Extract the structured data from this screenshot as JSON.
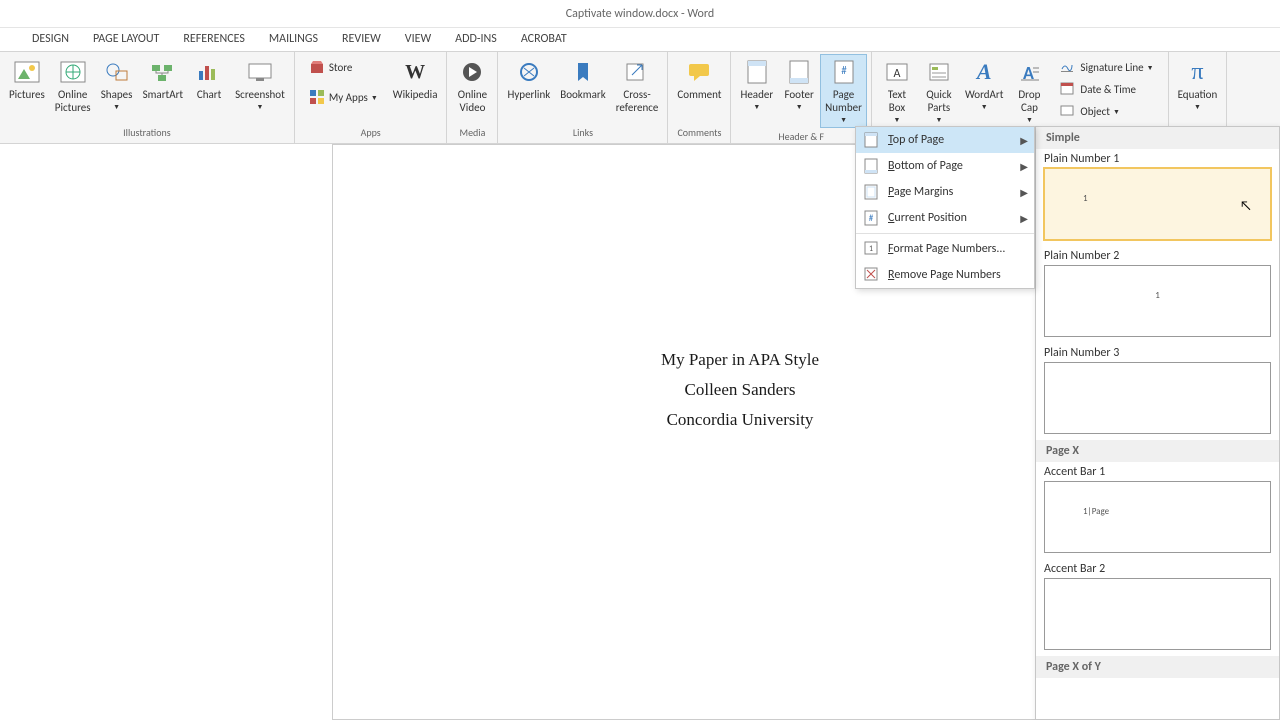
{
  "window": {
    "title": "Captivate window.docx - Word"
  },
  "tabs": [
    "DESIGN",
    "PAGE LAYOUT",
    "REFERENCES",
    "MAILINGS",
    "REVIEW",
    "VIEW",
    "ADD-INS",
    "ACROBAT"
  ],
  "ribbon": {
    "illustrations": {
      "label": "Illustrations",
      "pictures": "Pictures",
      "online_pictures": "Online\nPictures",
      "shapes": "Shapes",
      "smartart": "SmartArt",
      "chart": "Chart",
      "screenshot": "Screenshot"
    },
    "apps": {
      "label": "Apps",
      "store": "Store",
      "myapps": "My Apps",
      "wikipedia": "Wikipedia"
    },
    "media": {
      "label": "Media",
      "online_video": "Online\nVideo"
    },
    "links": {
      "label": "Links",
      "hyperlink": "Hyperlink",
      "bookmark": "Bookmark",
      "crossref": "Cross-\nreference"
    },
    "comments": {
      "label": "Comments",
      "comment": "Comment"
    },
    "header_footer": {
      "label": "Header & F",
      "header": "Header",
      "footer": "Footer",
      "page_number": "Page\nNumber"
    },
    "text": {
      "textbox": "Text\nBox",
      "quickparts": "Quick\nParts",
      "wordart": "WordArt",
      "dropcap": "Drop\nCap",
      "signature": "Signature Line",
      "datetime": "Date & Time",
      "object": "Object"
    },
    "symbols": {
      "equation": "Equation"
    }
  },
  "dropdown": {
    "top": "Top of Page",
    "bottom": "Bottom of Page",
    "margins": "Page Margins",
    "current": "Current Position",
    "format": "Format Page Numbers...",
    "remove": "Remove Page Numbers"
  },
  "gallery": {
    "simple": "Simple",
    "plain1": "Plain Number 1",
    "plain2": "Plain Number 2",
    "plain3": "Plain Number 3",
    "pagex": "Page X",
    "accent1": "Accent Bar 1",
    "accent1_text": "1|Page",
    "accent2": "Accent Bar 2",
    "pagexofy": "Page X of Y",
    "sample_digit": "1"
  },
  "document": {
    "line1": "My Paper in APA Style",
    "line2": "Colleen Sanders",
    "line3": "Concordia University"
  }
}
